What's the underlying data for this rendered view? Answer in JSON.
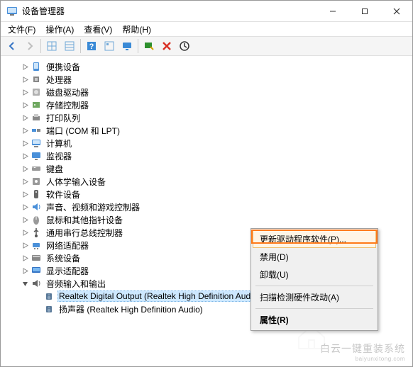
{
  "window": {
    "title": "设备管理器"
  },
  "menubar": {
    "file": "文件(F)",
    "action": "操作(A)",
    "view": "查看(V)",
    "help": "帮助(H)"
  },
  "tree": {
    "items": [
      {
        "label": "便携设备",
        "icon": "portable"
      },
      {
        "label": "处理器",
        "icon": "cpu"
      },
      {
        "label": "磁盘驱动器",
        "icon": "disk"
      },
      {
        "label": "存储控制器",
        "icon": "storage"
      },
      {
        "label": "打印队列",
        "icon": "printer"
      },
      {
        "label": "端口 (COM 和 LPT)",
        "icon": "port"
      },
      {
        "label": "计算机",
        "icon": "computer"
      },
      {
        "label": "监视器",
        "icon": "monitor"
      },
      {
        "label": "键盘",
        "icon": "keyboard"
      },
      {
        "label": "人体学输入设备",
        "icon": "hid"
      },
      {
        "label": "软件设备",
        "icon": "software"
      },
      {
        "label": "声音、视频和游戏控制器",
        "icon": "sound"
      },
      {
        "label": "鼠标和其他指针设备",
        "icon": "mouse"
      },
      {
        "label": "通用串行总线控制器",
        "icon": "usb"
      },
      {
        "label": "网络适配器",
        "icon": "network"
      },
      {
        "label": "系统设备",
        "icon": "system"
      },
      {
        "label": "显示适配器",
        "icon": "display"
      },
      {
        "label": "音频输入和输出",
        "icon": "audio",
        "expanded": true
      }
    ],
    "audio_children": [
      {
        "label": "Realtek Digital Output (Realtek High Definition Audio)",
        "icon": "speaker",
        "selected": true
      },
      {
        "label": "扬声器 (Realtek High Definition Audio)",
        "icon": "speaker"
      }
    ]
  },
  "context_menu": {
    "update": "更新驱动程序软件(P)...",
    "disable": "禁用(D)",
    "uninstall": "卸载(U)",
    "scan": "扫描检测硬件改动(A)",
    "properties": "属性(R)"
  },
  "watermark": {
    "main": "白云一键重装系统",
    "sub": "baiyunxitong.com"
  }
}
